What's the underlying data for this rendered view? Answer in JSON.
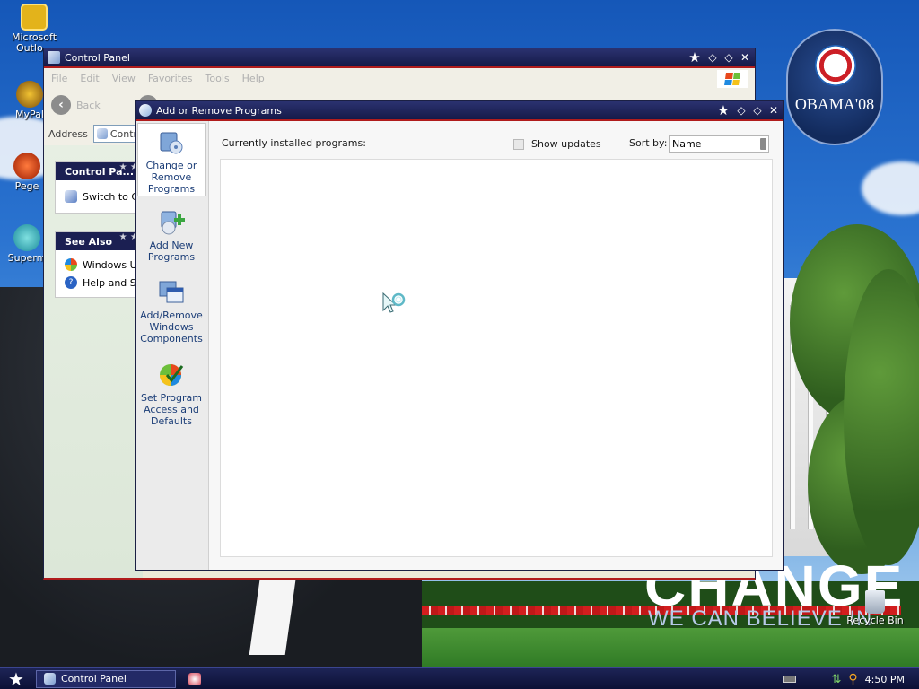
{
  "desktop": {
    "icons": [
      {
        "label": "Microsoft Outlo..."
      },
      {
        "label": "MyPal"
      },
      {
        "label": "Pege"
      },
      {
        "label": "Superm"
      },
      {
        "label": "Recycle Bin"
      }
    ],
    "wallpaper": {
      "logo_text": "OBAMA'08",
      "headline": "CHANGE",
      "tagline": "WE CAN BELIEVE IN"
    }
  },
  "control_panel": {
    "title": "Control Panel",
    "menu": [
      "File",
      "Edit",
      "View",
      "Favorites",
      "Tools",
      "Help"
    ],
    "toolbar": {
      "back_label": "Back"
    },
    "address_label": "Address",
    "address_value": "Control",
    "tasks_panel": {
      "heading": "Control Pa...",
      "items": [
        {
          "label": "Switch to C..."
        }
      ]
    },
    "see_also": {
      "heading": "See Also",
      "items": [
        {
          "label": "Windows U..."
        },
        {
          "label": "Help and Su..."
        }
      ]
    }
  },
  "arp": {
    "title": "Add or Remove Programs",
    "sidebar": [
      {
        "label": "Change or Remove Programs",
        "selected": true,
        "icon": "change-remove-programs-icon"
      },
      {
        "label": "Add New Programs",
        "selected": false,
        "icon": "add-new-programs-icon"
      },
      {
        "label": "Add/Remove Windows Components",
        "selected": false,
        "icon": "windows-components-icon"
      },
      {
        "label": "Set Program Access and Defaults",
        "selected": false,
        "icon": "program-defaults-icon"
      }
    ],
    "installed_label": "Currently installed programs:",
    "show_updates_label": "Show updates",
    "show_updates_checked": false,
    "sort_label": "Sort by:",
    "sort_value": "Name",
    "programs": []
  },
  "taskbar": {
    "tasks": [
      {
        "label": "Control Panel"
      }
    ],
    "clock": "4:50 PM"
  },
  "colors": {
    "titlebar": "#1b2044",
    "accent_red": "#b01c1c",
    "link_blue": "#1b3d77"
  }
}
